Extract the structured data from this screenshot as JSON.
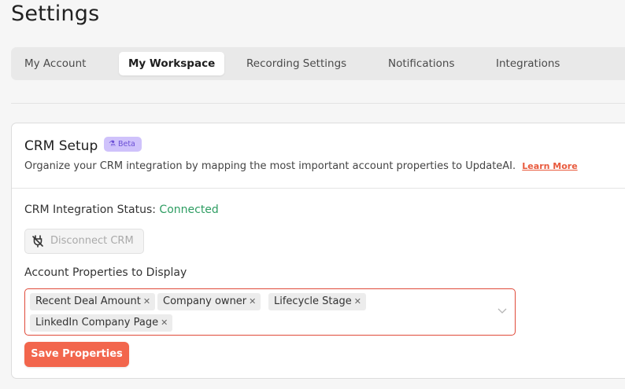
{
  "page": {
    "title": "Settings"
  },
  "tabs": [
    {
      "label": "My Account",
      "active": false
    },
    {
      "label": "My Workspace",
      "active": true
    },
    {
      "label": "Recording Settings",
      "active": false
    },
    {
      "label": "Notifications",
      "active": false
    },
    {
      "label": "Integrations",
      "active": false
    }
  ],
  "crm": {
    "title": "CRM Setup",
    "badge": "Beta",
    "badge_icon": "flask-icon",
    "description": "Organize your CRM integration by mapping the most important account properties to UpdateAI.",
    "learn_more": "Learn More",
    "status_label": "CRM Integration Status:",
    "status_value": "Connected",
    "disconnect_label": "Disconnect CRM",
    "disconnect_icon": "plug-off-icon",
    "properties_label": "Account Properties to Display",
    "selected_properties": [
      "Recent Deal Amount",
      "Company owner",
      "Lifecycle Stage",
      "LinkedIn Company Page"
    ],
    "save_label": "Save Properties"
  },
  "colors": {
    "accent": "#f2664d",
    "connected": "#2e9d62",
    "beta_bg": "#cfc2fb",
    "beta_text": "#6b4fd6",
    "error_border": "#e04a3a",
    "link": "#e85a3d"
  }
}
